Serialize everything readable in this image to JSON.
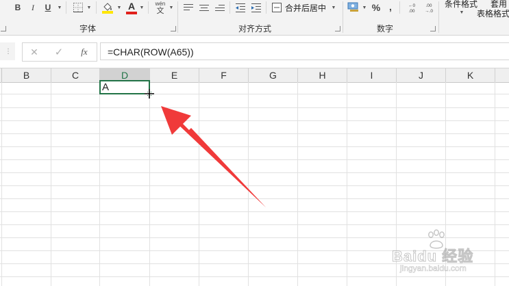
{
  "ribbon": {
    "font_group": {
      "label": "字体",
      "bold": "B",
      "italic": "I",
      "underline": "U",
      "font_color_letter": "A",
      "phonetic_top": "wén",
      "phonetic_bottom": "文"
    },
    "align_group": {
      "label": "对齐方式",
      "merge_center": "合并后居中"
    },
    "number_group": {
      "label": "数字",
      "percent": "%",
      "comma": ","
    },
    "styles": {
      "conditional_format": "条件格式",
      "table_format_top": "套用",
      "table_format_bottom": "表格格式"
    }
  },
  "formula_bar": {
    "cancel": "✕",
    "enter": "✓",
    "fx": "fx",
    "formula": "=CHAR(ROW(A65))"
  },
  "columns": [
    "B",
    "C",
    "D",
    "E",
    "F",
    "G",
    "H",
    "I",
    "J",
    "K"
  ],
  "active_column": "D",
  "active_cell": {
    "value": "A"
  },
  "colors": {
    "accent": "#217346",
    "arrow": "#f03a3a",
    "font_color_bar": "#e0201b",
    "fill_color_bar": "#ffe600"
  },
  "watermark": {
    "brand": "Baidu 经验",
    "url": "jingyan.baidu.com"
  }
}
